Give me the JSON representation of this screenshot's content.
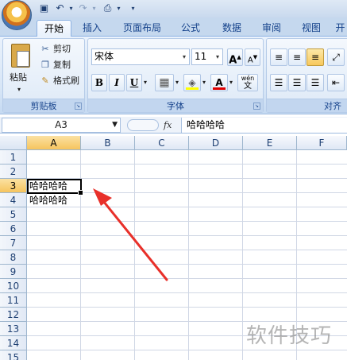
{
  "ribbon_tabs": [
    "开始",
    "插入",
    "页面布局",
    "公式",
    "数据",
    "审阅",
    "视图",
    "开"
  ],
  "clipboard": {
    "paste_label": "粘贴",
    "cut_label": "剪切",
    "copy_label": "复制",
    "format_painter_label": "格式刷",
    "group_label": "剪贴板"
  },
  "font": {
    "font_name": "宋体",
    "font_size": "11",
    "bold_label": "B",
    "italic_label": "I",
    "underline_label": "U",
    "font_color_label": "A",
    "wen_label": "wén",
    "grow_label": "A",
    "shrink_label": "A",
    "group_label": "字体"
  },
  "alignment": {
    "group_label": "对齐"
  },
  "formula_bar": {
    "name_box": "A3",
    "fx_label": "fx",
    "content": "哈哈哈哈"
  },
  "sheet": {
    "columns": [
      "A",
      "B",
      "C",
      "D",
      "E",
      "F"
    ],
    "rows": [
      "1",
      "2",
      "3",
      "4",
      "5",
      "6",
      "7",
      "8",
      "9",
      "10",
      "11",
      "12",
      "13",
      "14",
      "15"
    ],
    "selected_column": "A",
    "selected_row": "3",
    "cells": {
      "A3": "哈哈哈哈",
      "A4": "哈哈哈哈"
    }
  },
  "watermark": "软件技巧",
  "colors": {
    "annotation_arrow": "#e8302a",
    "selection_header": "#f6c45e"
  }
}
